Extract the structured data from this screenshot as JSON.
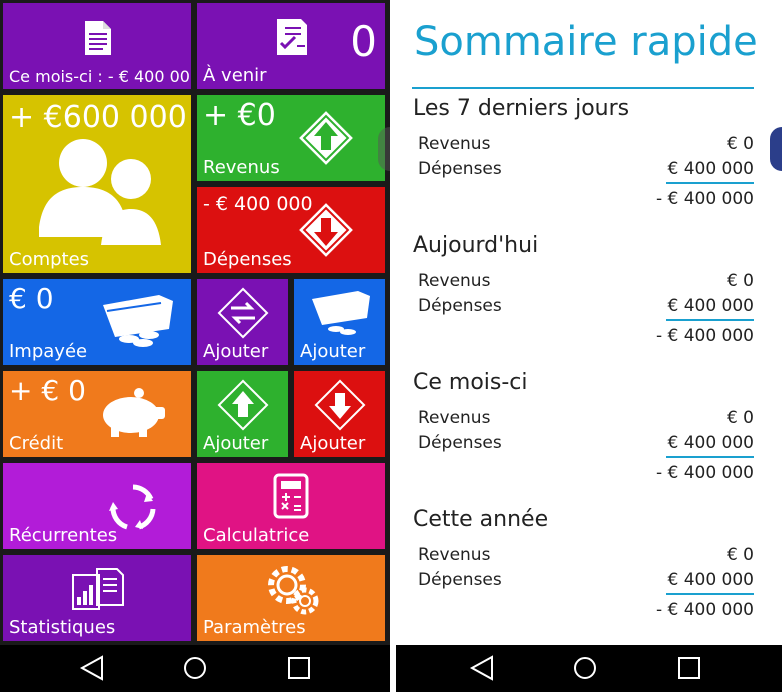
{
  "left_screen": {
    "tiles": {
      "month": {
        "label": "Ce mois-ci : - € 400 000",
        "color": "#7a11b3"
      },
      "upcoming": {
        "label": "À venir",
        "count": "0",
        "color": "#7a11b3"
      },
      "accounts": {
        "value": "+ €600 000",
        "label": "Comptes",
        "color": "#d6c300"
      },
      "income": {
        "value": "+ €0",
        "label": "Revenus",
        "color": "#2eb12e"
      },
      "expenses": {
        "value": "- € 400 000",
        "label": "Dépenses",
        "color": "#dc1010"
      },
      "unpaid": {
        "value": "€ 0",
        "label": "Impayée",
        "color": "#1467e6"
      },
      "transfer_add": {
        "label": "Ajouter",
        "color": "#7a11b3"
      },
      "unpaid_add": {
        "label": "Ajouter",
        "color": "#1467e6"
      },
      "credit": {
        "value": "+ € 0",
        "label": "Crédit",
        "color": "#f07a1c"
      },
      "income_add": {
        "label": "Ajouter",
        "color": "#2eb12e"
      },
      "expense_add": {
        "label": "Ajouter",
        "color": "#dc1010"
      },
      "recurring": {
        "label": "Récurrentes",
        "color": "#b21cd8"
      },
      "calculator": {
        "label": "Calculatrice",
        "color": "#e01384"
      },
      "statistics": {
        "label": "Statistiques",
        "color": "#7a11b3"
      },
      "settings": {
        "label": "Paramètres",
        "color": "#f07a1c"
      }
    }
  },
  "right_screen": {
    "title": "Sommaire rapide",
    "accent_color": "#1aa0cf",
    "sections": [
      {
        "heading": "Les 7 derniers jours",
        "income_label": "Revenus",
        "income_value": "€ 0",
        "expense_label": "Dépenses",
        "expense_value": "€ 400 000",
        "total": "- € 400 000"
      },
      {
        "heading": "Aujourd'hui",
        "income_label": "Revenus",
        "income_value": "€ 0",
        "expense_label": "Dépenses",
        "expense_value": "€ 400 000",
        "total": "- € 400 000"
      },
      {
        "heading": "Ce mois-ci",
        "income_label": "Revenus",
        "income_value": "€ 0",
        "expense_label": "Dépenses",
        "expense_value": "€ 400 000",
        "total": "- € 400 000"
      },
      {
        "heading": "Cette année",
        "income_label": "Revenus",
        "income_value": "€ 0",
        "expense_label": "Dépenses",
        "expense_value": "€ 400 000",
        "total": "- € 400 000"
      }
    ]
  },
  "navbar": {
    "back_icon": "back-triangle-icon",
    "home_icon": "home-circle-icon",
    "recents_icon": "recents-square-icon"
  }
}
